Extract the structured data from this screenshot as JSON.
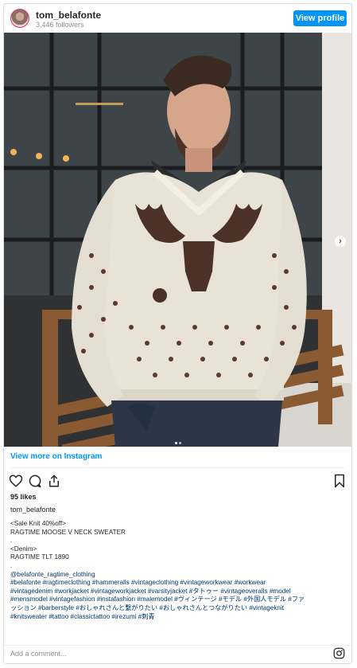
{
  "post": {
    "username": "tom_belafonte",
    "followers": "3,446 followers",
    "view_profile_label": "View profile",
    "view_more_label": "View more on Instagram",
    "likes": "95 likes",
    "caption_owner": "tom_belafonte",
    "caption_lines": [
      "<Sale Knit 40%off>",
      "RAGTIME MOOSE V NECK SWEATER",
      ".",
      "<Denim>",
      "RAGTIME TLT 1890",
      "."
    ],
    "caption_handle": "@belafonte_ragtime_clothing",
    "hashtag_lines": [
      "#belafonte #ragtimeclothing #hammeralls #vintageclothing #vintageworkwear #workwear",
      "#vintagedenim #workjacket #vintageworkjacket #varsityjacket #タトゥー #vintageoveralls #model",
      "#mensmodel #vintagefashion #instafashion #malemodel #ヴィンテージ #モデル #外国人モデル #ファ",
      "ッション #barberstyle #おしゃれさんと繋がりたい #おしゃれさんとつながりたい #vintageknit",
      "#knitsweater #tattoo #classictattoo #irezumi #刺青"
    ],
    "add_comment_placeholder": "Add a comment...",
    "carousel_count": 2,
    "carousel_active": 1
  },
  "icons": {
    "like": "heart-icon",
    "comment": "comment-icon",
    "share": "share-icon",
    "save": "bookmark-icon",
    "next": "chevron-right-icon",
    "instagram": "instagram-logo-icon"
  },
  "colors": {
    "accent": "#0095f6",
    "link": "#00376b",
    "muted": "#8e8e8e"
  }
}
